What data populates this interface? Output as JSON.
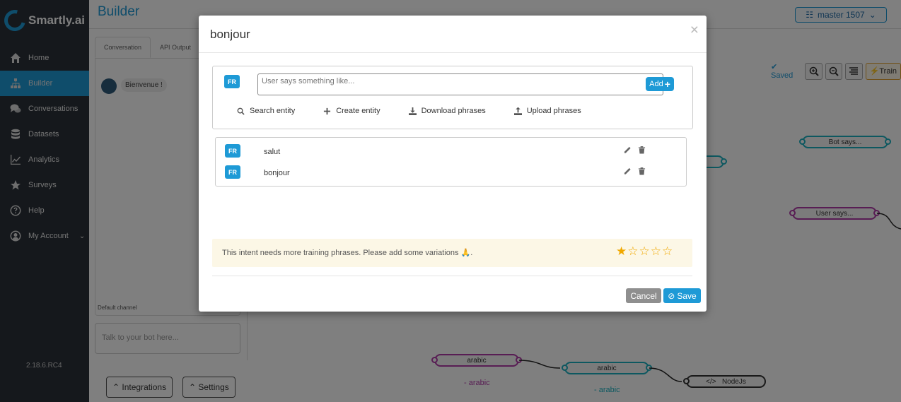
{
  "app": {
    "logo_text": "Smartly.ai",
    "version": "2.18.6.RC4"
  },
  "sidebar": {
    "items": [
      {
        "label": "Home",
        "icon": "home-icon"
      },
      {
        "label": "Builder",
        "icon": "sitemap-icon",
        "active": true
      },
      {
        "label": "Conversations",
        "icon": "comments-icon"
      },
      {
        "label": "Datasets",
        "icon": "database-icon"
      },
      {
        "label": "Analytics",
        "icon": "line-chart-icon"
      },
      {
        "label": "Surveys",
        "icon": "star-icon"
      },
      {
        "label": "Help",
        "icon": "help-icon"
      },
      {
        "label": "My Account",
        "icon": "user-circle-icon",
        "has_chevron": true
      }
    ]
  },
  "header": {
    "title": "Builder",
    "branch": "master 1507"
  },
  "chat_panel": {
    "tabs": [
      "Conversation",
      "API Output"
    ],
    "bot_message": "Bienvenue !",
    "default_channel": "Default channel",
    "input_placeholder": "Talk to your bot here..."
  },
  "bottom_buttons": {
    "integrations": "Integrations",
    "settings": "Settings"
  },
  "toolbar": {
    "saved": "Saved",
    "train": "Train"
  },
  "canvas": {
    "bot_says": "Bot says...",
    "user_says": "User says...",
    "arabic_user": "arabic",
    "arabic_user_sub": "- arabic",
    "arabic_bot": "arabic",
    "arabic_bot_sub": "- arabic",
    "nodejs": "NodeJs"
  },
  "modal": {
    "title": "bonjour",
    "close": "×",
    "lang": "FR",
    "input_placeholder": "User says something like...",
    "add_label": "Add",
    "actions": {
      "search_entity": "Search entity",
      "create_entity": "Create entity",
      "download_phrases": "Download phrases",
      "upload_phrases": "Upload phrases"
    },
    "phrases": [
      {
        "lang": "FR",
        "text": "salut"
      },
      {
        "lang": "FR",
        "text": "bonjour"
      }
    ],
    "warning": "This intent needs more training phrases. Please add some variations 🙏.",
    "rating": {
      "value": 1,
      "max": 5
    },
    "cancel": "Cancel",
    "save": "Save",
    "colors": {
      "accent": "#1e9ad6",
      "warning_bg": "#fcf7e6",
      "star": "#f0a800"
    }
  }
}
